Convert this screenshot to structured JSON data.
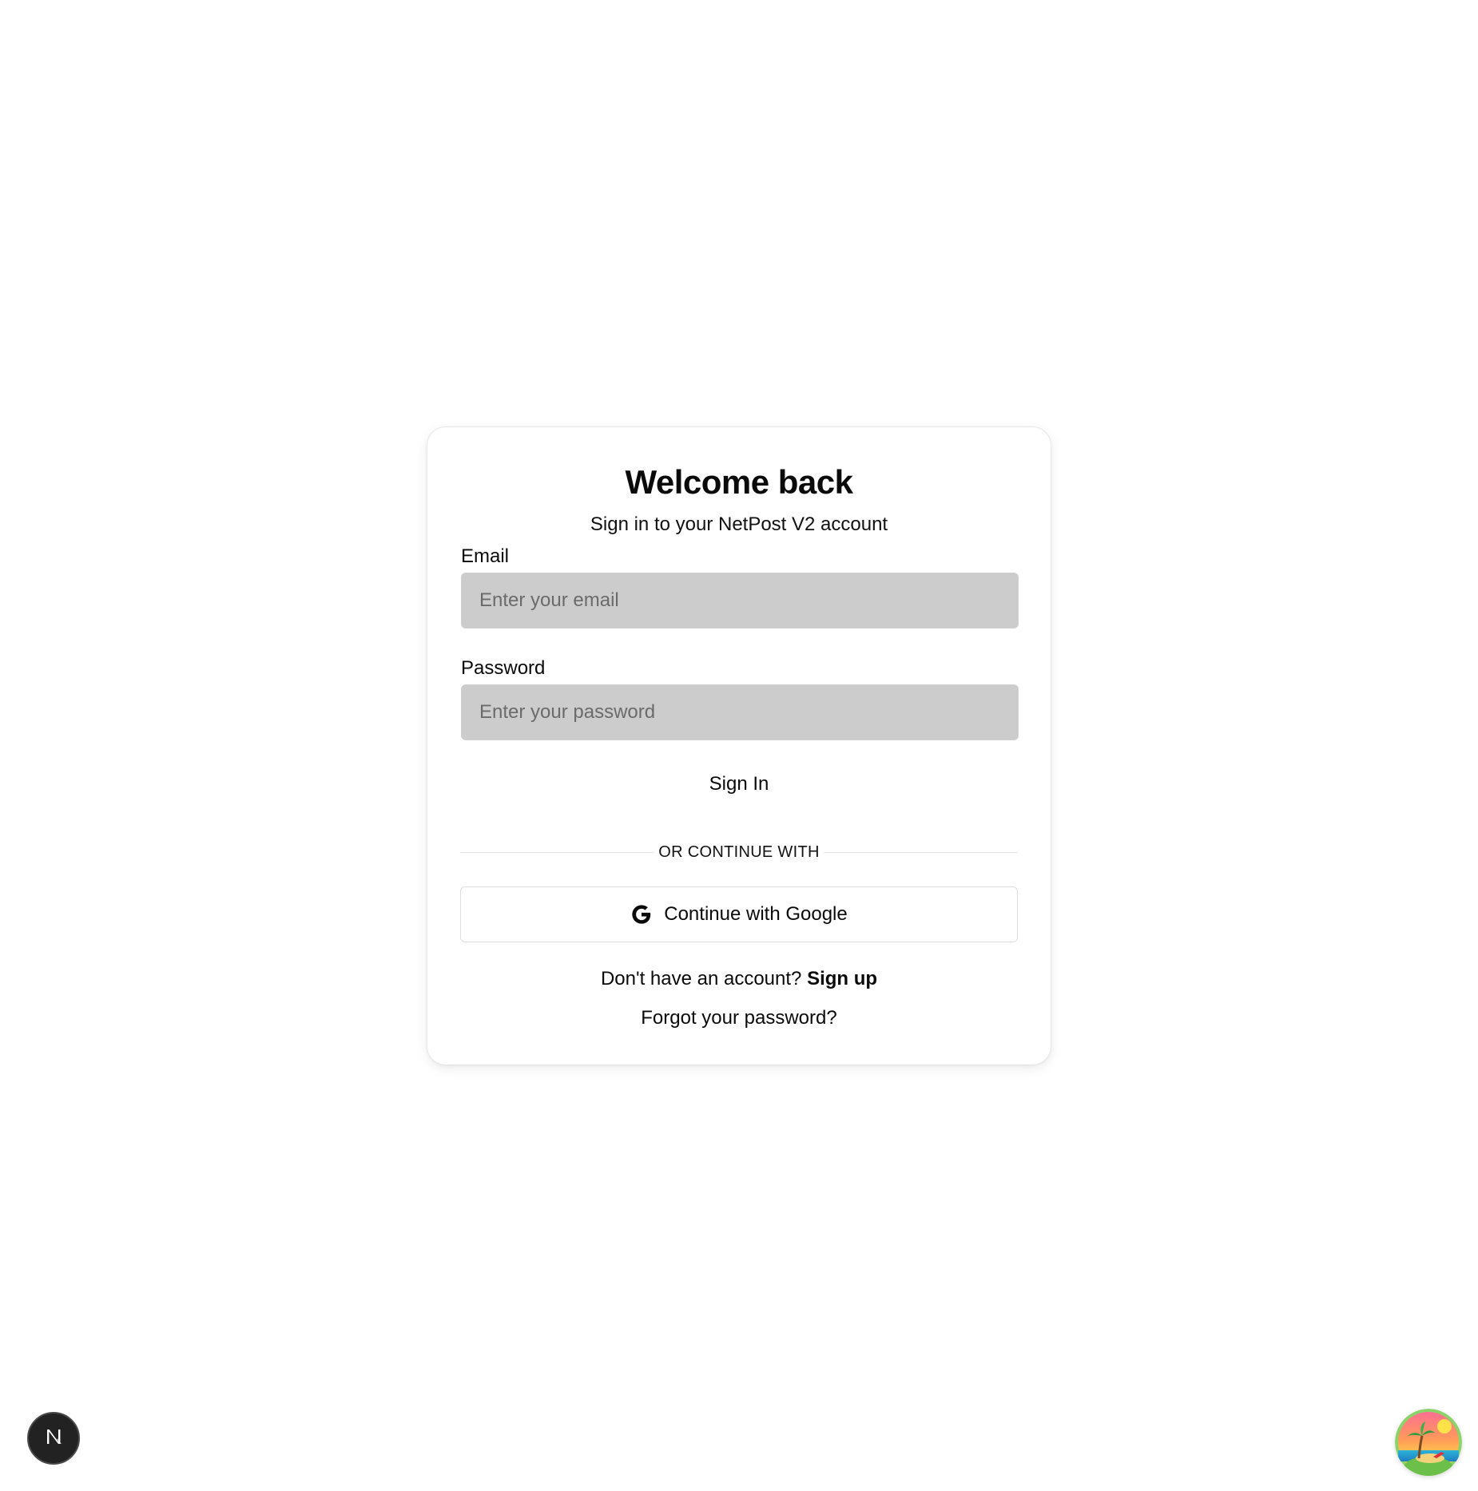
{
  "card": {
    "title": "Welcome back",
    "subtitle": "Sign in to your NetPost V2 account"
  },
  "form": {
    "email": {
      "label": "Email",
      "placeholder": "Enter your email",
      "value": ""
    },
    "password": {
      "label": "Password",
      "placeholder": "Enter your password",
      "value": ""
    },
    "submit_label": "Sign In"
  },
  "divider": {
    "text": "OR CONTINUE WITH"
  },
  "google": {
    "label": "Continue with Google",
    "icon": "google-g-icon"
  },
  "footer": {
    "signup_prompt": "Don't have an account?",
    "signup_link": "Sign up",
    "forgot_link": "Forgot your password?"
  },
  "badges": {
    "dev_badge_icon": "next-n-icon",
    "avatar_icon": "beach-island-avatar"
  },
  "colors": {
    "input_bg": "#cccccc",
    "text": "#0a0a0a",
    "badge_bg": "#222222"
  }
}
